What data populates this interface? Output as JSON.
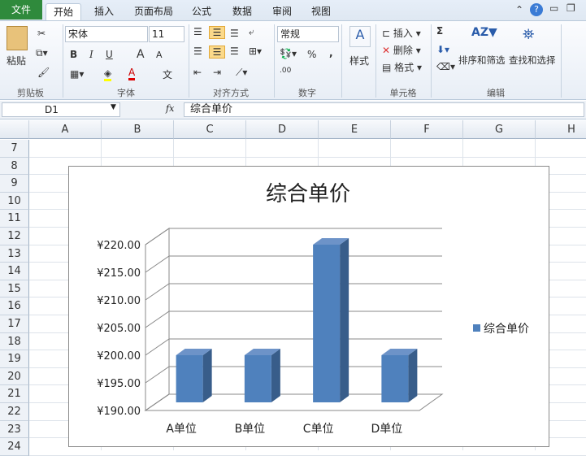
{
  "tabs": [
    "文件",
    "开始",
    "插入",
    "页面布局",
    "公式",
    "数据",
    "审阅",
    "视图"
  ],
  "ribbon": {
    "clipboard": {
      "paste": "粘贴",
      "label": "剪贴板"
    },
    "font": {
      "name": "宋体",
      "size": "11",
      "bold": "B",
      "italic": "I",
      "underline": "U",
      "grow": "A",
      "shrink": "A",
      "color_a": "A",
      "phonetic": "文",
      "label": "字体"
    },
    "alignment": {
      "label": "对齐方式"
    },
    "number": {
      "format": "常规",
      "percent": "%",
      "comma": ",",
      "decimal": ".00",
      "label": "数字"
    },
    "styles": {
      "label": "样式"
    },
    "cells": {
      "insert": "插入",
      "delete": "删除",
      "format": "格式",
      "label": "单元格"
    },
    "editing": {
      "sum": "Σ",
      "sort": "排序和筛选",
      "find": "查找和选择",
      "label": "编辑"
    }
  },
  "formula_bar": {
    "name_box": "D1",
    "fx": "fx",
    "content": "综合单价"
  },
  "columns": [
    "A",
    "B",
    "C",
    "D",
    "E",
    "F",
    "G",
    "H"
  ],
  "rows": [
    "7",
    "8",
    "9",
    "10",
    "11",
    "12",
    "13",
    "14",
    "15",
    "16",
    "17",
    "18",
    "19",
    "20",
    "21",
    "22",
    "23",
    "24"
  ],
  "chart_data": {
    "type": "bar",
    "title": "综合单价",
    "categories": [
      "A单位",
      "B单位",
      "C单位",
      "D单位"
    ],
    "series": [
      {
        "name": "综合单价",
        "values": [
          200,
          200,
          220,
          200
        ]
      }
    ],
    "yticks": [
      "¥190.00",
      "¥195.00",
      "¥200.00",
      "¥205.00",
      "¥210.00",
      "¥215.00",
      "¥220.00"
    ],
    "ylim": [
      190,
      220
    ],
    "legend": "right",
    "bar_color": "#4f81bd"
  }
}
